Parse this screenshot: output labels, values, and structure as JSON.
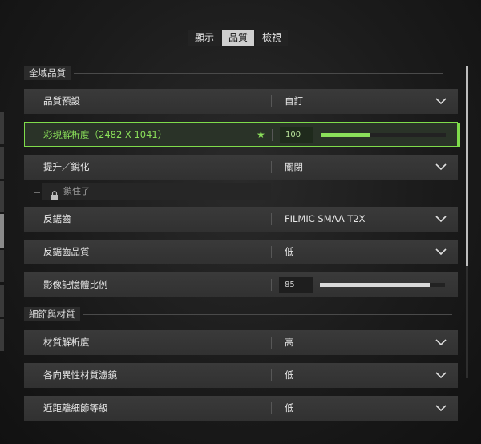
{
  "tabs": [
    {
      "label": "顯示",
      "active": false
    },
    {
      "label": "品質",
      "active": true
    },
    {
      "label": "檢視",
      "active": false
    }
  ],
  "sections": {
    "global": "全域品質",
    "detail": "細節與材質"
  },
  "rows": {
    "quality_preset": {
      "label": "品質預設",
      "value": "自訂"
    },
    "render_resolution": {
      "label": "彩現解析度（2482 X 1041）",
      "value": "100",
      "fill": 0.4
    },
    "upscaling": {
      "label": "提升／銳化",
      "value": "關閉"
    },
    "locked": {
      "label": "鎖住了"
    },
    "anti_aliasing": {
      "label": "反鋸齒",
      "value": "FILMIC SMAA T2X"
    },
    "aa_quality": {
      "label": "反鋸齒品質",
      "value": "低"
    },
    "memory_ratio": {
      "label": "影像記憶體比例",
      "value": "85",
      "fill": 0.88
    },
    "texture_resolution": {
      "label": "材質解析度",
      "value": "高"
    },
    "anisotropic": {
      "label": "各向異性材質濾鏡",
      "value": "低"
    },
    "near_lod": {
      "label": "近距離細節等級",
      "value": "低"
    }
  },
  "icons": {
    "star": "★",
    "chevron": "chevron-down-icon",
    "lock": "lock-icon"
  },
  "colors": {
    "accent": "#7fdc4b",
    "slider_fill_selected": "#8be05a",
    "slider_fill": "#d9d9d9"
  }
}
